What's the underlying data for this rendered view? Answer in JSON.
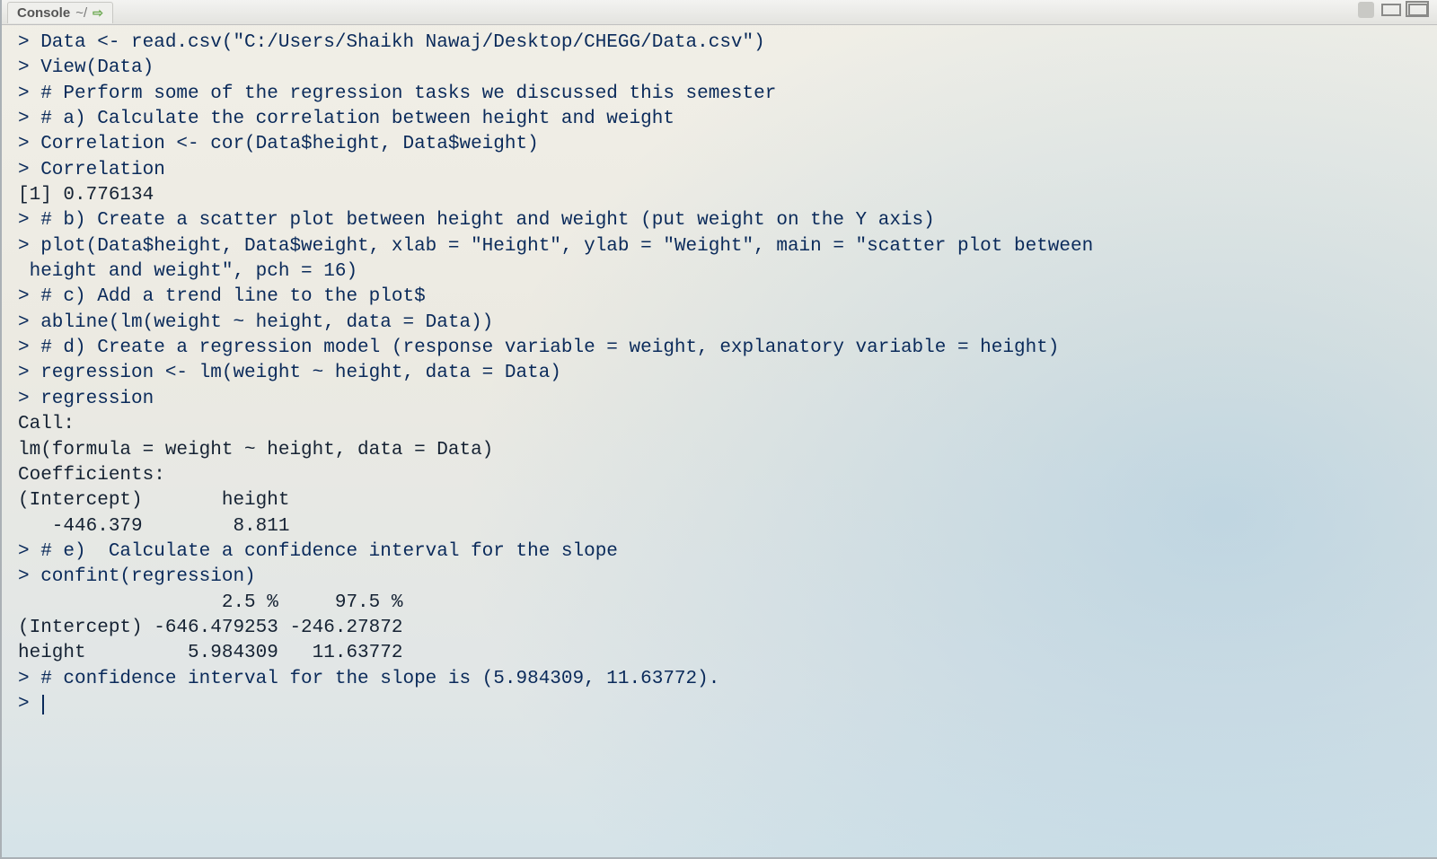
{
  "tab": {
    "title": "Console",
    "path": "~/",
    "arrow": "⇨"
  },
  "window_controls": {
    "brush": "brush-icon",
    "restore": "restore-icon",
    "stack": "stack-icon"
  },
  "console": {
    "lines": [
      {
        "k": "p",
        "t": "> Data <- read.csv(\"C:/Users/Shaikh Nawaj/Desktop/CHEGG/Data.csv\")"
      },
      {
        "k": "p",
        "t": "> View(Data)"
      },
      {
        "k": "p",
        "t": "> # Perform some of the regression tasks we discussed this semester"
      },
      {
        "k": "p",
        "t": "> # a) Calculate the correlation between height and weight"
      },
      {
        "k": "p",
        "t": "> Correlation <- cor(Data$height, Data$weight)"
      },
      {
        "k": "p",
        "t": "> Correlation"
      },
      {
        "k": "o",
        "t": "[1] 0.776134"
      },
      {
        "k": "p",
        "t": "> # b) Create a scatter plot between height and weight (put weight on the Y axis)"
      },
      {
        "k": "p",
        "t": "> plot(Data$height, Data$weight, xlab = \"Height\", ylab = \"Weight\", main = \"scatter plot between"
      },
      {
        "k": "p",
        "t": " height and weight\", pch = 16)"
      },
      {
        "k": "p",
        "t": "> # c) Add a trend line to the plot$"
      },
      {
        "k": "p",
        "t": "> abline(lm(weight ~ height, data = Data))"
      },
      {
        "k": "p",
        "t": "> # d) Create a regression model (response variable = weight, explanatory variable = height)"
      },
      {
        "k": "p",
        "t": "> regression <- lm(weight ~ height, data = Data)"
      },
      {
        "k": "p",
        "t": "> regression"
      },
      {
        "k": "o",
        "t": ""
      },
      {
        "k": "o",
        "t": "Call:"
      },
      {
        "k": "o",
        "t": "lm(formula = weight ~ height, data = Data)"
      },
      {
        "k": "o",
        "t": ""
      },
      {
        "k": "o",
        "t": "Coefficients:"
      },
      {
        "k": "o",
        "t": "(Intercept)       height  "
      },
      {
        "k": "o",
        "t": "   -446.379        8.811  "
      },
      {
        "k": "o",
        "t": ""
      },
      {
        "k": "p",
        "t": "> # e)  Calculate a confidence interval for the slope"
      },
      {
        "k": "p",
        "t": "> confint(regression)"
      },
      {
        "k": "o",
        "t": "                  2.5 %     97.5 %"
      },
      {
        "k": "o",
        "t": "(Intercept) -646.479253 -246.27872"
      },
      {
        "k": "o",
        "t": "height         5.984309   11.63772"
      },
      {
        "k": "p",
        "t": "> # confidence interval for the slope is (5.984309, 11.63772)."
      },
      {
        "k": "cur",
        "t": "> "
      }
    ]
  },
  "regression_data": {
    "correlation": 0.776134,
    "coefficients": {
      "intercept": -446.379,
      "height": 8.811
    },
    "confint": {
      "levels": [
        "2.5 %",
        "97.5 %"
      ],
      "intercept": [
        -646.479253,
        -246.27872
      ],
      "height": [
        5.984309,
        11.63772
      ]
    }
  }
}
